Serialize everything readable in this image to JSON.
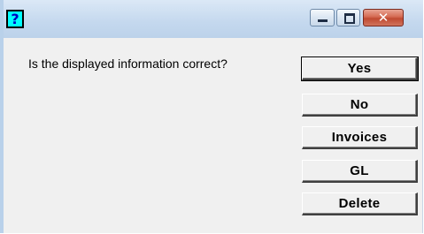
{
  "titlebar": {
    "app_icon_glyph": "?",
    "app_icon": "question-mark-icon",
    "minimize_icon": "minimize-icon",
    "maximize_icon": "maximize-icon",
    "close_icon": "close-icon",
    "close_glyph": "✕"
  },
  "dialog": {
    "message": "Is the displayed information correct?",
    "buttons": {
      "yes": "Yes",
      "no": "No",
      "invoices": "Invoices",
      "gl": "GL",
      "delete": "Delete"
    }
  },
  "colors": {
    "title_bar": "#c4d8ee",
    "icon_background": "#00ffff",
    "close_button": "#c04a31",
    "dialog_background": "#f0f0f0"
  }
}
